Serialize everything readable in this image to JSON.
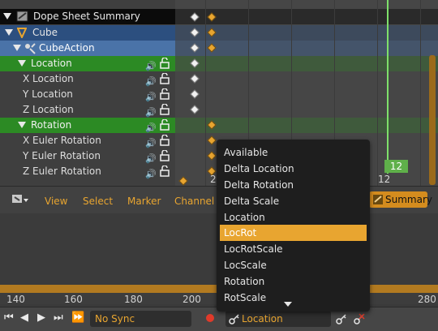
{
  "channels": {
    "summary": "Dope Sheet Summary",
    "object": "Cube",
    "action": "CubeAction",
    "group_location": "Location",
    "location_channels": [
      "X Location",
      "Y Location",
      "Z Location"
    ],
    "group_rotation": "Rotation",
    "rotation_channels": [
      "X Euler Rotation",
      "Y Euler Rotation",
      "Z Euler Rotation"
    ]
  },
  "timeline": {
    "current_frame": "12",
    "visible_frame_labels": [
      "2",
      "12"
    ]
  },
  "header": {
    "menus": [
      "View",
      "Select",
      "Marker",
      "Channel"
    ],
    "summary_button": "Summary"
  },
  "ruler": {
    "labels": [
      "140",
      "160",
      "180",
      "200",
      "280"
    ]
  },
  "toolbar": {
    "sync_mode": "No Sync",
    "keying_set": "Location"
  },
  "dropdown": {
    "options": [
      "Available",
      "Delta Location",
      "Delta Rotation",
      "Delta Scale",
      "Location",
      "LocRot",
      "LocRotScale",
      "LocScale",
      "Rotation",
      "RotScale"
    ],
    "selected": "LocRot"
  },
  "colors": {
    "accent": "#e8a530",
    "group": "#2c8a24",
    "object_row": "#2c4f7f",
    "action_row": "#4a73a8",
    "frame_indicator": "#7ee06a",
    "selected_option": "#e8a530"
  },
  "icons": {
    "speaker": "speaker-icon",
    "lock": "lock-icon",
    "record": "record-icon",
    "keyframe": "keyframe-icon"
  }
}
